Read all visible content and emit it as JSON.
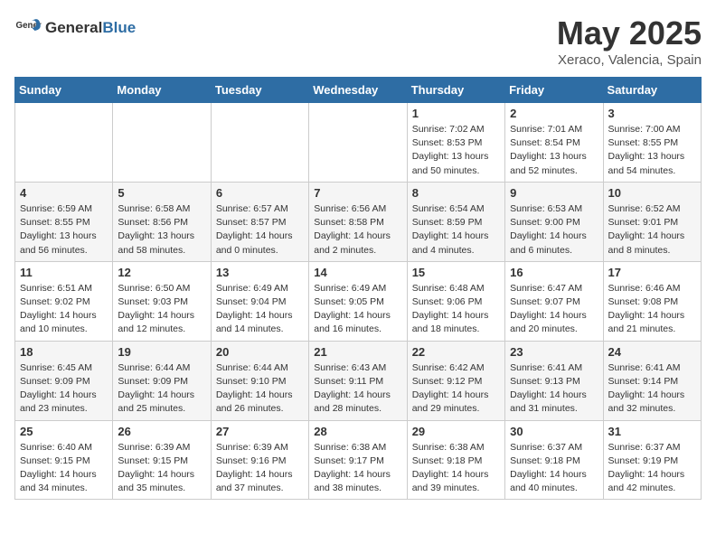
{
  "header": {
    "logo_general": "General",
    "logo_blue": "Blue",
    "title": "May 2025",
    "location": "Xeraco, Valencia, Spain"
  },
  "days_of_week": [
    "Sunday",
    "Monday",
    "Tuesday",
    "Wednesday",
    "Thursday",
    "Friday",
    "Saturday"
  ],
  "weeks": [
    [
      {
        "day": "",
        "info": ""
      },
      {
        "day": "",
        "info": ""
      },
      {
        "day": "",
        "info": ""
      },
      {
        "day": "",
        "info": ""
      },
      {
        "day": "1",
        "info": "Sunrise: 7:02 AM\nSunset: 8:53 PM\nDaylight: 13 hours\nand 50 minutes."
      },
      {
        "day": "2",
        "info": "Sunrise: 7:01 AM\nSunset: 8:54 PM\nDaylight: 13 hours\nand 52 minutes."
      },
      {
        "day": "3",
        "info": "Sunrise: 7:00 AM\nSunset: 8:55 PM\nDaylight: 13 hours\nand 54 minutes."
      }
    ],
    [
      {
        "day": "4",
        "info": "Sunrise: 6:59 AM\nSunset: 8:55 PM\nDaylight: 13 hours\nand 56 minutes."
      },
      {
        "day": "5",
        "info": "Sunrise: 6:58 AM\nSunset: 8:56 PM\nDaylight: 13 hours\nand 58 minutes."
      },
      {
        "day": "6",
        "info": "Sunrise: 6:57 AM\nSunset: 8:57 PM\nDaylight: 14 hours\nand 0 minutes."
      },
      {
        "day": "7",
        "info": "Sunrise: 6:56 AM\nSunset: 8:58 PM\nDaylight: 14 hours\nand 2 minutes."
      },
      {
        "day": "8",
        "info": "Sunrise: 6:54 AM\nSunset: 8:59 PM\nDaylight: 14 hours\nand 4 minutes."
      },
      {
        "day": "9",
        "info": "Sunrise: 6:53 AM\nSunset: 9:00 PM\nDaylight: 14 hours\nand 6 minutes."
      },
      {
        "day": "10",
        "info": "Sunrise: 6:52 AM\nSunset: 9:01 PM\nDaylight: 14 hours\nand 8 minutes."
      }
    ],
    [
      {
        "day": "11",
        "info": "Sunrise: 6:51 AM\nSunset: 9:02 PM\nDaylight: 14 hours\nand 10 minutes."
      },
      {
        "day": "12",
        "info": "Sunrise: 6:50 AM\nSunset: 9:03 PM\nDaylight: 14 hours\nand 12 minutes."
      },
      {
        "day": "13",
        "info": "Sunrise: 6:49 AM\nSunset: 9:04 PM\nDaylight: 14 hours\nand 14 minutes."
      },
      {
        "day": "14",
        "info": "Sunrise: 6:49 AM\nSunset: 9:05 PM\nDaylight: 14 hours\nand 16 minutes."
      },
      {
        "day": "15",
        "info": "Sunrise: 6:48 AM\nSunset: 9:06 PM\nDaylight: 14 hours\nand 18 minutes."
      },
      {
        "day": "16",
        "info": "Sunrise: 6:47 AM\nSunset: 9:07 PM\nDaylight: 14 hours\nand 20 minutes."
      },
      {
        "day": "17",
        "info": "Sunrise: 6:46 AM\nSunset: 9:08 PM\nDaylight: 14 hours\nand 21 minutes."
      }
    ],
    [
      {
        "day": "18",
        "info": "Sunrise: 6:45 AM\nSunset: 9:09 PM\nDaylight: 14 hours\nand 23 minutes."
      },
      {
        "day": "19",
        "info": "Sunrise: 6:44 AM\nSunset: 9:09 PM\nDaylight: 14 hours\nand 25 minutes."
      },
      {
        "day": "20",
        "info": "Sunrise: 6:44 AM\nSunset: 9:10 PM\nDaylight: 14 hours\nand 26 minutes."
      },
      {
        "day": "21",
        "info": "Sunrise: 6:43 AM\nSunset: 9:11 PM\nDaylight: 14 hours\nand 28 minutes."
      },
      {
        "day": "22",
        "info": "Sunrise: 6:42 AM\nSunset: 9:12 PM\nDaylight: 14 hours\nand 29 minutes."
      },
      {
        "day": "23",
        "info": "Sunrise: 6:41 AM\nSunset: 9:13 PM\nDaylight: 14 hours\nand 31 minutes."
      },
      {
        "day": "24",
        "info": "Sunrise: 6:41 AM\nSunset: 9:14 PM\nDaylight: 14 hours\nand 32 minutes."
      }
    ],
    [
      {
        "day": "25",
        "info": "Sunrise: 6:40 AM\nSunset: 9:15 PM\nDaylight: 14 hours\nand 34 minutes."
      },
      {
        "day": "26",
        "info": "Sunrise: 6:39 AM\nSunset: 9:15 PM\nDaylight: 14 hours\nand 35 minutes."
      },
      {
        "day": "27",
        "info": "Sunrise: 6:39 AM\nSunset: 9:16 PM\nDaylight: 14 hours\nand 37 minutes."
      },
      {
        "day": "28",
        "info": "Sunrise: 6:38 AM\nSunset: 9:17 PM\nDaylight: 14 hours\nand 38 minutes."
      },
      {
        "day": "29",
        "info": "Sunrise: 6:38 AM\nSunset: 9:18 PM\nDaylight: 14 hours\nand 39 minutes."
      },
      {
        "day": "30",
        "info": "Sunrise: 6:37 AM\nSunset: 9:18 PM\nDaylight: 14 hours\nand 40 minutes."
      },
      {
        "day": "31",
        "info": "Sunrise: 6:37 AM\nSunset: 9:19 PM\nDaylight: 14 hours\nand 42 minutes."
      }
    ]
  ]
}
